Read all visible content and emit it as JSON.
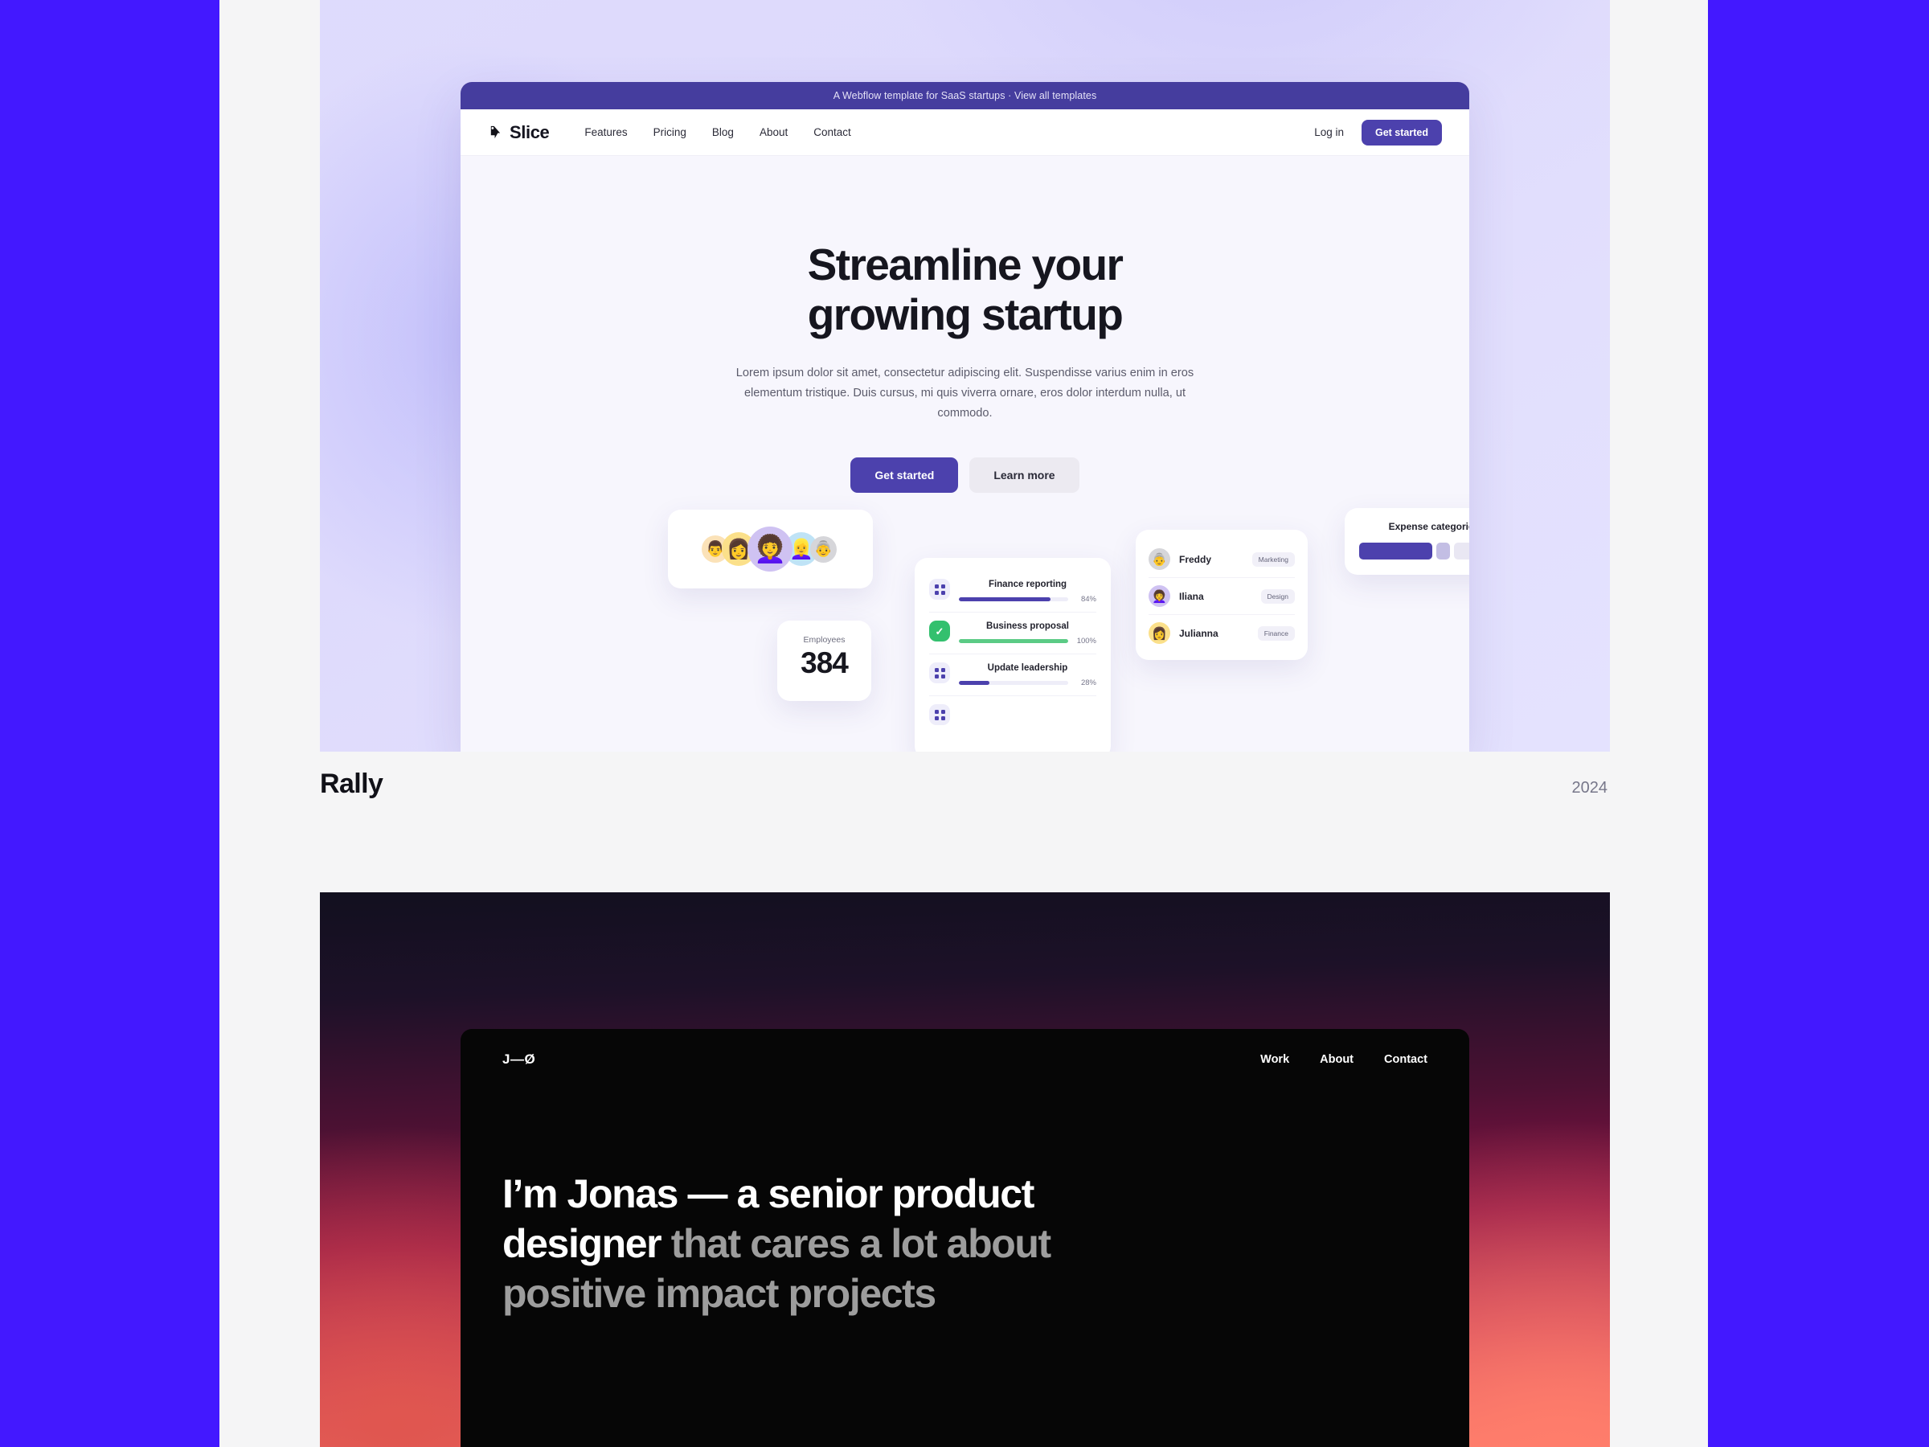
{
  "theme": {
    "rail_color": "#4318FF",
    "page_bg": "#F5F5F6",
    "slice_accent": "#4C41AD",
    "slice_banner": "#453D9E",
    "done_green": "#33C06E"
  },
  "projects": [
    {
      "caption_title": "Rally",
      "caption_year": "2024",
      "site": {
        "announcement": "A Webflow template for SaaS startups · View all templates",
        "brand": "Slice",
        "nav_links": [
          "Features",
          "Pricing",
          "Blog",
          "About",
          "Contact"
        ],
        "login_label": "Log in",
        "nav_cta": "Get started",
        "hero_title_line1": "Streamline your",
        "hero_title_line2": "growing startup",
        "hero_paragraph": "Lorem ipsum dolor sit amet, consectetur adipiscing elit. Suspendisse varius enim in eros elementum tristique. Duis cursus, mi quis viverra ornare, eros dolor interdum nulla, ut commodo.",
        "hero_primary_cta": "Get started",
        "hero_secondary_cta": "Learn more",
        "cards": {
          "avatars": [
            {
              "emoji": "👨",
              "bg": "#FBE2B8"
            },
            {
              "emoji": "👩",
              "bg": "#FBE08A"
            },
            {
              "emoji": "👩‍🦱",
              "bg": "#CFC2F2"
            },
            {
              "emoji": "👱‍♀️",
              "bg": "#BFE3F6"
            },
            {
              "emoji": "👵",
              "bg": "#D6D6DA"
            }
          ],
          "employees_label": "Employees",
          "employees_value": "384",
          "tasks": [
            {
              "name": "Finance reporting",
              "percent": "84%",
              "fill": 84,
              "color": "#4C41AD",
              "icon": "grid-icon",
              "state": "in-progress"
            },
            {
              "name": "Business proposal",
              "percent": "100%",
              "fill": 100,
              "color": "#5BCB85",
              "icon": "check-icon",
              "state": "done"
            },
            {
              "name": "Update leadership",
              "percent": "28%",
              "fill": 28,
              "color": "#4C41AD",
              "icon": "grid-icon",
              "state": "in-progress"
            }
          ],
          "people": [
            {
              "name": "Freddy",
              "tag": "Marketing",
              "emoji": "👵",
              "bg": "#D6D6DA"
            },
            {
              "name": "Iliana",
              "tag": "Design",
              "emoji": "👩‍🦱",
              "bg": "#CFC2F2"
            },
            {
              "name": "Julianna",
              "tag": "Finance",
              "emoji": "👩",
              "bg": "#FBE08A"
            }
          ],
          "expense_title": "Expense categories",
          "expense_segments": [
            {
              "width": 49,
              "color": "#4C41AD"
            },
            {
              "width": 9,
              "color": "#C3BEE4"
            },
            {
              "width": 36,
              "color": "#E9E7F3"
            }
          ]
        }
      }
    },
    {
      "site": {
        "logo": "J—Ø",
        "nav_links": [
          "Work",
          "About",
          "Contact"
        ],
        "headline_strong": "I’m Jonas — a senior product designer",
        "headline_rest": " that cares a lot about positive impact projects"
      }
    }
  ]
}
